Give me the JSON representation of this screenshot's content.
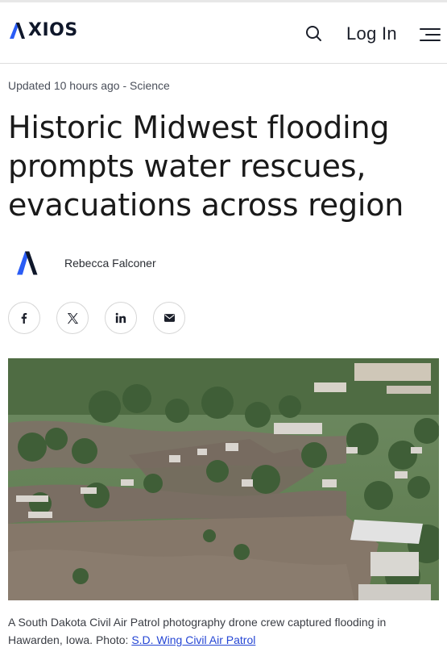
{
  "header": {
    "logo_text": "XIOS",
    "login_label": "Log In",
    "icons": {
      "search": "search-icon",
      "menu": "hamburger-menu-icon",
      "logo": "axios-logo"
    }
  },
  "article": {
    "updated": "Updated 10 hours ago",
    "separator": " - ",
    "section": "Science",
    "headline": "Historic Midwest flooding prompts water rescues, evacuations across region",
    "author": "Rebecca Falconer",
    "share": [
      {
        "name": "facebook",
        "icon": "facebook-icon"
      },
      {
        "name": "x",
        "icon": "x-icon"
      },
      {
        "name": "linkedin",
        "icon": "linkedin-icon"
      },
      {
        "name": "email",
        "icon": "email-icon"
      }
    ],
    "image_alt": "Aerial view of flooded town with houses surrounded by brown floodwater",
    "caption_text": "A South Dakota Civil Air Patrol photography drone crew captured flooding in Hawarden, Iowa. Photo: ",
    "caption_link": "S.D. Wing Civil Air Patrol"
  },
  "colors": {
    "logo_accent": "#2a5cf5",
    "logo_dark": "#0f172a",
    "link": "#2546d4",
    "flood_water": "#7a6e63"
  }
}
